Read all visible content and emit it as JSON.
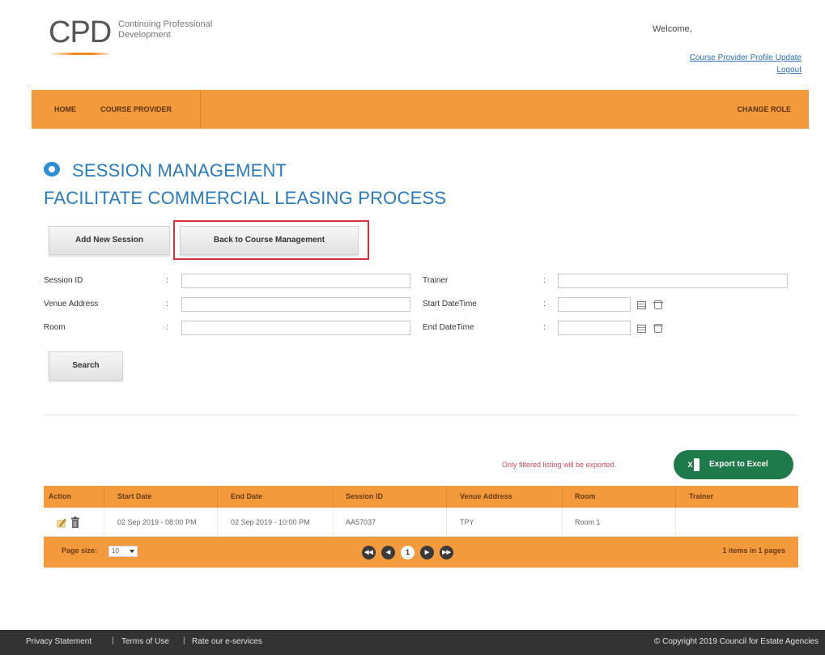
{
  "header": {
    "logo_text": "CPD",
    "logo_sub_line1": "Continuing Professional",
    "logo_sub_line2": "Development",
    "welcome": "Welcome,",
    "profile_link": "Course Provider Profile Update",
    "logout_link": "Logout"
  },
  "nav": {
    "home": "HOME",
    "course_provider": "COURSE PROVIDER",
    "change_role": "CHANGE ROLE"
  },
  "page": {
    "title": "SESSION MANAGEMENT",
    "subtitle": "FACILITATE COMMERCIAL LEASING PROCESS"
  },
  "buttons": {
    "add_session": "Add New Session",
    "back": "Back to Course Management",
    "search": "Search"
  },
  "form": {
    "colon": ":",
    "session_id_label": "Session ID",
    "session_id_value": "",
    "venue_label": "Venue Address",
    "venue_value": "",
    "room_label": "Room",
    "room_value": "",
    "trainer_label": "Trainer",
    "trainer_value": "",
    "start_label": "Start DateTime",
    "start_value": "",
    "end_label": "End DateTime",
    "end_value": ""
  },
  "export": {
    "note": "Only filtered listing will be exported.",
    "button": "Export to Excel"
  },
  "table": {
    "headers": [
      "Action",
      "Start Date",
      "End Date",
      "Session ID",
      "Venue Address",
      "Room",
      "Trainer"
    ],
    "rows": [
      {
        "start_date": "02 Sep 2019 - 08:00 PM",
        "end_date": "02 Sep 2019 - 10:00 PM",
        "session_id": "AA57037",
        "venue": "TPY",
        "room": "Room 1",
        "trainer": ""
      }
    ],
    "page_size_label": "Page size:",
    "page_size_value": "10",
    "pager": {
      "first": "◀◀",
      "prev": "◀",
      "current": "1",
      "next": "▶",
      "last": "▶▶"
    },
    "items_info": "1 items in 1 pages"
  },
  "footer": {
    "privacy": "Privacy Statement",
    "separator": "|",
    "terms": "Terms of Use",
    "rate": "Rate our e-services",
    "copyright": "© Copyright 2019 Council for Estate Agencies"
  },
  "colors": {
    "accent": "#f39a3c",
    "title_blue": "#2a7ac0",
    "export_green": "#1e7a4a",
    "highlight_red": "#d6303a",
    "footer_bg": "#333333"
  },
  "icons": [
    "logo",
    "session-icon",
    "calendar-icon",
    "clock-icon",
    "excel-icon",
    "edit-icon",
    "delete-icon"
  ]
}
